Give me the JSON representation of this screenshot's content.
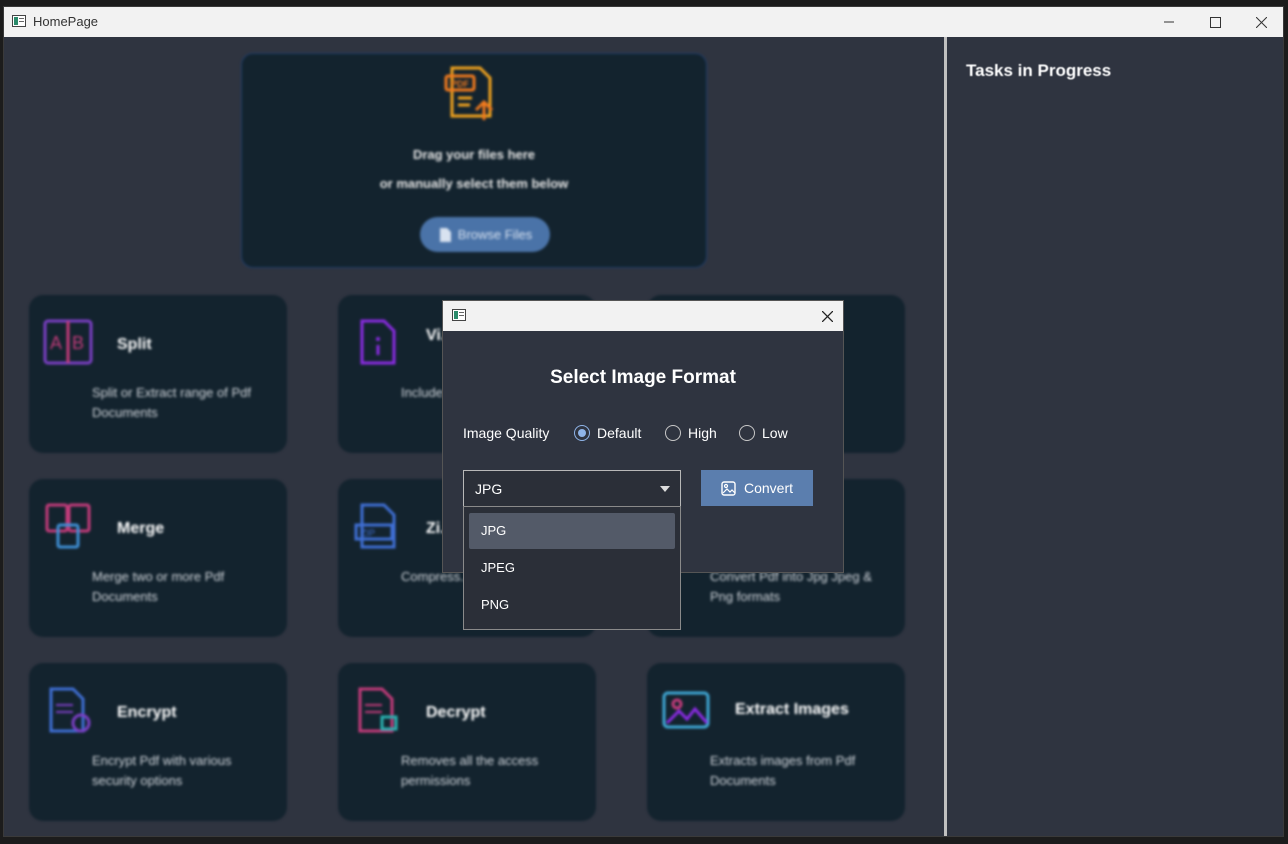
{
  "window": {
    "title": "HomePage"
  },
  "dropzone": {
    "line1": "Drag your files here",
    "line2": "or manually select them below",
    "browse_label": "Browse Files"
  },
  "cards": [
    {
      "title": "Split",
      "desc": "Split or Extract range of Pdf Documents",
      "icon": "split-icon"
    },
    {
      "title": "Vi... M...",
      "desc": "Include... date, p...",
      "icon": "metadata-icon"
    },
    {
      "title": "",
      "desc": "",
      "icon": ""
    },
    {
      "title": "Merge",
      "desc": "Merge two or more Pdf Documents",
      "icon": "merge-icon"
    },
    {
      "title": "Zi...",
      "desc": "Compress... .zip forma...",
      "icon": "zip-icon"
    },
    {
      "title": "",
      "desc": "Convert Pdf into Jpg Jpeg & Png formats",
      "icon": "convert-icon"
    },
    {
      "title": "Encrypt",
      "desc": "Encrypt Pdf with various security options",
      "icon": "encrypt-icon"
    },
    {
      "title": "Decrypt",
      "desc": "Removes all the access permissions",
      "icon": "decrypt-icon"
    },
    {
      "title": "Extract Images",
      "desc": "Extracts images from Pdf Documents",
      "icon": "image-icon"
    }
  ],
  "tasks": {
    "title": "Tasks in Progress"
  },
  "dialog": {
    "heading": "Select Image Format",
    "quality_label": "Image Quality",
    "quality_options": [
      "Default",
      "High",
      "Low"
    ],
    "quality_selected": "Default",
    "format_value": "JPG",
    "format_options": [
      "JPG",
      "JPEG",
      "PNG"
    ],
    "convert_label": "Convert"
  }
}
